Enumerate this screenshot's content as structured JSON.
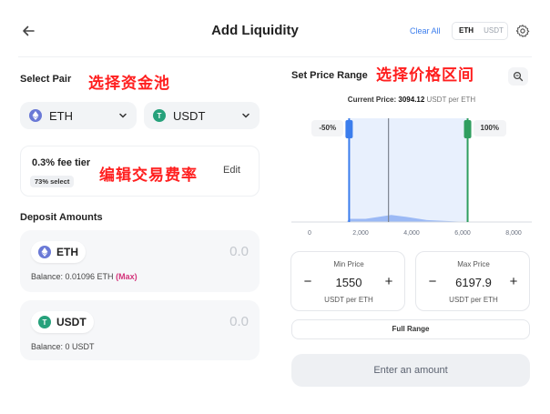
{
  "header": {
    "title": "Add Liquidity",
    "clear_all": "Clear All",
    "toggle": [
      "ETH",
      "USDT"
    ],
    "icons": {
      "back": "arrow-left-icon",
      "settings": "gear-icon"
    }
  },
  "select_pair": {
    "label": "Select Pair",
    "annotation": "选择资金池",
    "token_a": {
      "symbol": "ETH",
      "icon": "eth-coin-icon"
    },
    "token_b": {
      "symbol": "USDT",
      "icon": "usdt-coin-icon"
    }
  },
  "fee_tier": {
    "text": "0.3% fee tier",
    "badge": "73% select",
    "edit": "Edit",
    "annotation": "编辑交易费率"
  },
  "deposit": {
    "label": "Deposit Amounts",
    "eth": {
      "symbol": "ETH",
      "amount": "0.0",
      "balance_prefix": "Balance: 0.01096 ETH",
      "max": "(Max)"
    },
    "usdt": {
      "symbol": "USDT",
      "amount": "0.0",
      "balance_prefix": "Balance: 0 USDT"
    }
  },
  "price_range": {
    "label": "Set Price Range",
    "annotation": "选择价格区间",
    "current_price_label": "Current Price:",
    "current_price_value": "3094.12",
    "current_price_unit": "USDT per ETH",
    "min_pct": "-50%",
    "max_pct": "100%",
    "min": {
      "label": "Min Price",
      "value": "1550",
      "unit": "USDT per ETH",
      "minus": "−",
      "plus": "+"
    },
    "max": {
      "label": "Max Price",
      "value": "6197.9",
      "unit": "USDT per ETH",
      "minus": "−",
      "plus": "+"
    },
    "full_range": "Full Range",
    "submit": "Enter an amount"
  },
  "chart_data": {
    "type": "area",
    "title": "",
    "xlim": [
      0,
      8000
    ],
    "x_ticks": [
      0,
      2000,
      4000,
      6000,
      8000
    ],
    "x_tick_labels": [
      "0",
      "2,000",
      "4,000",
      "6,000",
      "8,000"
    ],
    "current_price": 3094.12,
    "range_min": 1550,
    "range_max": 6197.9,
    "liquidity": [
      [
        1450,
        0
      ],
      [
        1550,
        0.25
      ],
      [
        2200,
        0.25
      ],
      [
        2700,
        0.4
      ],
      [
        3200,
        0.55
      ],
      [
        3800,
        0.4
      ],
      [
        4600,
        0.15
      ],
      [
        6200,
        0
      ]
    ],
    "colors": {
      "min_handle": "#3b7ded",
      "max_handle": "#2f9e5f",
      "range_fill": "#e8f0fd",
      "current_line": "#7d8591"
    }
  }
}
